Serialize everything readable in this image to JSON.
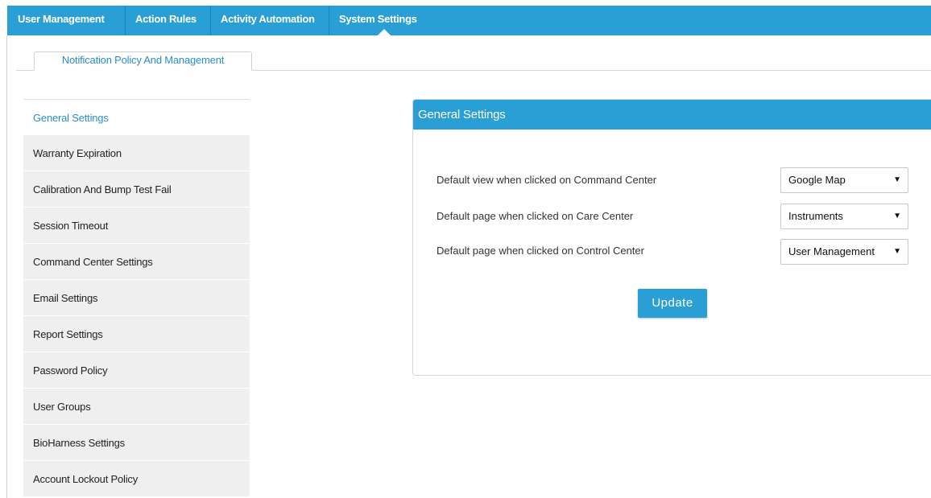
{
  "topnav": {
    "items": [
      {
        "label": "User Management"
      },
      {
        "label": "Action Rules"
      },
      {
        "label": "Activity Automation"
      },
      {
        "label": "System Settings",
        "active": true
      }
    ]
  },
  "subtabs": [
    {
      "label": "Notification Policy And Management",
      "active": true
    }
  ],
  "sidebar": {
    "items": [
      {
        "label": "General Settings",
        "active": true
      },
      {
        "label": "Warranty Expiration"
      },
      {
        "label": "Calibration And Bump Test Fail"
      },
      {
        "label": "Session Timeout"
      },
      {
        "label": "Command Center Settings"
      },
      {
        "label": "Email Settings"
      },
      {
        "label": "Report Settings"
      },
      {
        "label": "Password Policy"
      },
      {
        "label": "User Groups"
      },
      {
        "label": "BioHarness Settings"
      },
      {
        "label": "Account Lockout Policy"
      }
    ]
  },
  "panel": {
    "title": "General Settings",
    "rows": [
      {
        "label": "Default view when clicked on Command Center",
        "value": "Google Map"
      },
      {
        "label": "Default page when clicked on Care Center",
        "value": "Instruments"
      },
      {
        "label": "Default page when clicked on Control Center",
        "value": "User Management"
      }
    ],
    "update_label": "Update"
  },
  "icons": {
    "dropdown": "▼"
  },
  "colors": {
    "accent": "#2a9fd6",
    "link": "#2a8fc9",
    "sidebar_bg": "#efefef"
  }
}
